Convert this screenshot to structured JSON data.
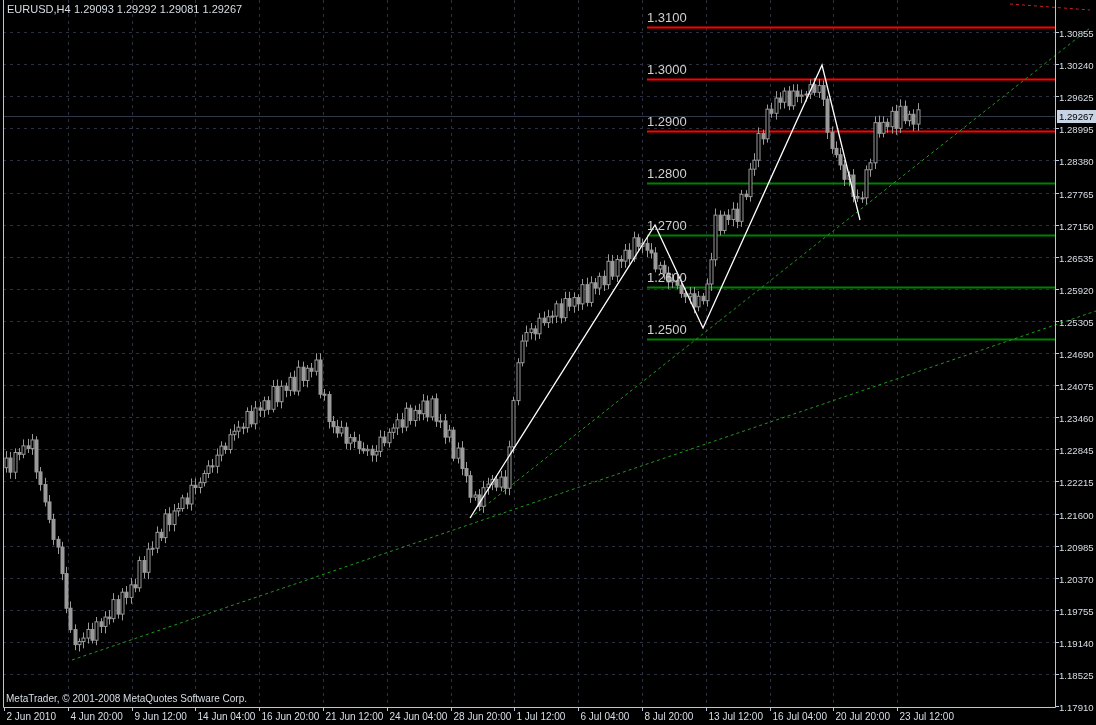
{
  "chart": {
    "title": "EURUSD,H4",
    "ohlc": [
      "1.29093",
      "1.29292",
      "1.29081",
      "1.29267"
    ]
  },
  "price_axis": {
    "labels": [
      "1.30855",
      "1.30240",
      "1.29625",
      "1.28995",
      "1.28380",
      "1.27765",
      "1.27150",
      "1.26535",
      "1.25920",
      "1.25305",
      "1.24690",
      "1.24075",
      "1.23460",
      "1.22845",
      "1.22215",
      "1.21600",
      "1.20985",
      "1.20370",
      "1.19755",
      "1.19140",
      "1.18525",
      "1.17910"
    ],
    "current_price": "1.29267"
  },
  "time_axis": {
    "labels": [
      "2 Jun 2010",
      "4 Jun 20:00",
      "9 Jun 12:00",
      "14 Jun 04:00",
      "16 Jun 20:00",
      "21 Jun 12:00",
      "24 Jun 04:00",
      "28 Jun 20:00",
      "1 Jul 12:00",
      "6 Jul 04:00",
      "8 Jul 20:00",
      "13 Jul 12:00",
      "16 Jul 04:00",
      "20 Jul 20:00",
      "23 Jul 12:00"
    ]
  },
  "levels": [
    {
      "label": "1.3100",
      "color": "#ff0000"
    },
    {
      "label": "1.3000",
      "color": "#ff0000"
    },
    {
      "label": "1.2900",
      "color": "#ff0000"
    },
    {
      "label": "1.2800",
      "color": "#008000"
    },
    {
      "label": "1.2700",
      "color": "#008000"
    },
    {
      "label": "1.2600",
      "color": "#008000"
    },
    {
      "label": "1.2500",
      "color": "#008000"
    }
  ],
  "copyright": "MetaTrader, © 2001-2008 MetaQuotes Software Corp."
}
